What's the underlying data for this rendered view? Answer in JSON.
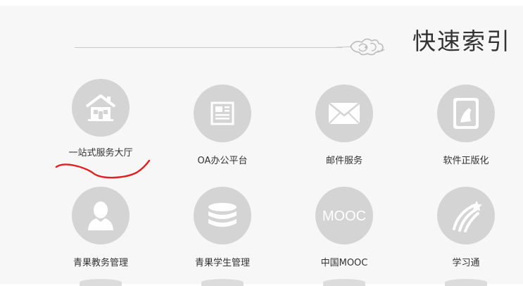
{
  "header": {
    "title": "快速索引"
  },
  "tiles": [
    {
      "label": "一站式服务大厅",
      "icon": "house-icon"
    },
    {
      "label": "OA办公平台",
      "icon": "newspaper-icon"
    },
    {
      "label": "邮件服务",
      "icon": "envelope-icon"
    },
    {
      "label": "软件正版化",
      "icon": "software-disc-icon"
    },
    {
      "label": "青果教务管理",
      "icon": "user-silhouette-icon"
    },
    {
      "label": "青果学生管理",
      "icon": "database-icon"
    },
    {
      "label": "中国MOOC",
      "icon": "mooc-logo-icon",
      "icon_text": "MOOC"
    },
    {
      "label": "学习通",
      "icon": "shooting-star-icon"
    }
  ],
  "colors": {
    "panel_bg": "#f7f7f7",
    "icon_circle": "#d4d4d4",
    "icon_glyph": "#ffffff",
    "text": "#333333",
    "annotation": "#e02020"
  }
}
